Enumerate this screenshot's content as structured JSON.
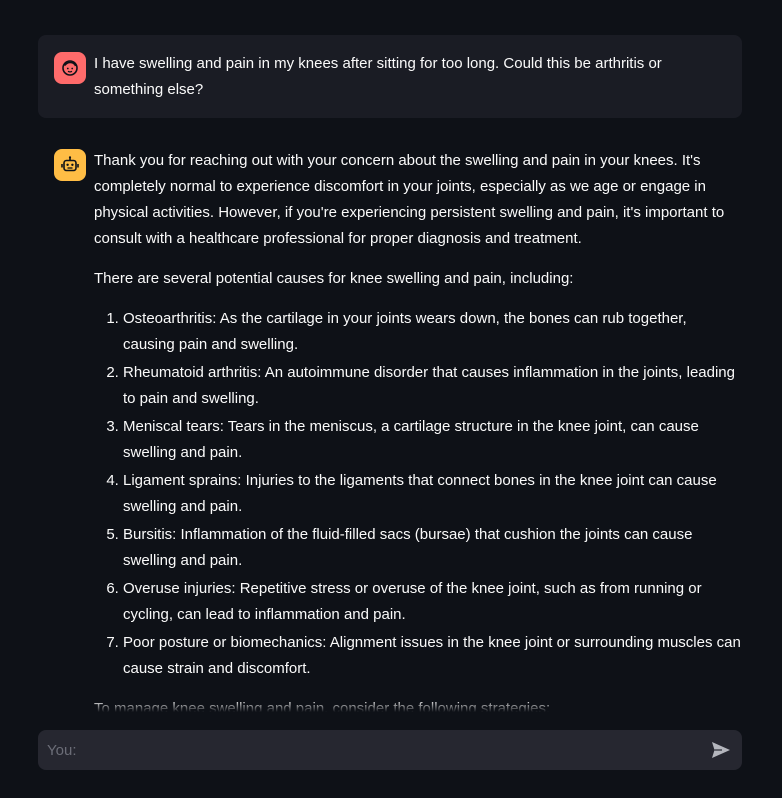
{
  "conversation": {
    "user_message": {
      "avatar_icon": "user-face-icon",
      "text": "I have swelling and pain in my knees after sitting for too long. Could this be arthritis or something else?"
    },
    "assistant_message": {
      "avatar_icon": "robot-icon",
      "intro": "Thank you for reaching out with your concern about the swelling and pain in your knees. It's completely normal to experience discomfort in your joints, especially as we age or engage in physical activities. However, if you're experiencing persistent swelling and pain, it's important to consult with a healthcare professional for proper diagnosis and treatment.",
      "causes_heading": "There are several potential causes for knee swelling and pain, including:",
      "causes": [
        "Osteoarthritis: As the cartilage in your joints wears down, the bones can rub together, causing pain and swelling.",
        "Rheumatoid arthritis: An autoimmune disorder that causes inflammation in the joints, leading to pain and swelling.",
        "Meniscal tears: Tears in the meniscus, a cartilage structure in the knee joint, can cause swelling and pain.",
        "Ligament sprains: Injuries to the ligaments that connect bones in the knee joint can cause swelling and pain.",
        "Bursitis: Inflammation of the fluid-filled sacs (bursae) that cushion the joints can cause swelling and pain.",
        "Overuse injuries: Repetitive stress or overuse of the knee joint, such as from running or cycling, can lead to inflammation and pain.",
        "Poor posture or biomechanics: Alignment issues in the knee joint or surrounding muscles can cause strain and discomfort."
      ],
      "strategies_heading": "To manage knee swelling and pain, consider the following strategies:"
    }
  },
  "chat_input": {
    "placeholder": "You:",
    "value": "",
    "send_icon": "send-icon"
  },
  "colors": {
    "background": "#0e1117",
    "user_bubble": "#1a1c24",
    "user_avatar": "#ff6b6b",
    "bot_avatar": "#ffbd45",
    "input_bg": "#262730"
  }
}
